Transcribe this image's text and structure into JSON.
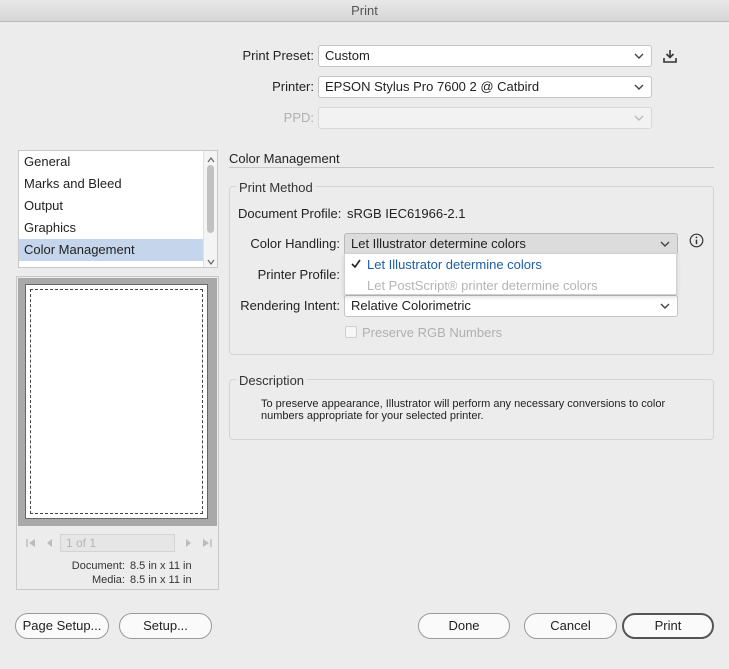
{
  "window": {
    "title": "Print"
  },
  "top": {
    "print_preset_label": "Print Preset:",
    "print_preset_value": "Custom",
    "printer_label": "Printer:",
    "printer_value": "EPSON Stylus Pro 7600 2 @ Catbird",
    "ppd_label": "PPD:",
    "ppd_value": ""
  },
  "sidebar": {
    "items": [
      {
        "label": "General"
      },
      {
        "label": "Marks and Bleed"
      },
      {
        "label": "Output"
      },
      {
        "label": "Graphics"
      },
      {
        "label": "Color Management"
      }
    ],
    "selected_index": 4
  },
  "preview": {
    "page_field": "1 of 1",
    "document_label": "Document:",
    "document_value": "8.5 in x 11 in",
    "media_label": "Media:",
    "media_value": "8.5 in x 11 in"
  },
  "color_management": {
    "title": "Color Management",
    "print_method": {
      "title": "Print Method",
      "document_profile_label": "Document Profile:",
      "document_profile_value": "sRGB IEC61966-2.1",
      "color_handling_label": "Color Handling:",
      "color_handling_value": "Let Illustrator determine colors",
      "color_handling_options": [
        {
          "label": "Let Illustrator determine colors",
          "selected": true,
          "enabled": true
        },
        {
          "label": "Let PostScript® printer determine colors",
          "selected": false,
          "enabled": false
        }
      ],
      "printer_profile_label": "Printer Profile:",
      "rendering_intent_label": "Rendering Intent:",
      "rendering_intent_value": "Relative Colorimetric",
      "preserve_rgb_label": "Preserve RGB Numbers"
    },
    "description": {
      "title": "Description",
      "text": "To preserve appearance, Illustrator will perform any necessary conversions to color numbers appropriate for your selected printer."
    }
  },
  "buttons": {
    "page_setup": "Page Setup...",
    "setup": "Setup...",
    "done": "Done",
    "cancel": "Cancel",
    "print": "Print"
  },
  "colors": {
    "selection": "#c5d5ec",
    "accent_text": "#1c5ea6",
    "window_bg": "#ececec"
  },
  "icons": {
    "save_preset": "save-preset-icon",
    "info": "info-icon",
    "checkmark": "checkmark-icon"
  }
}
